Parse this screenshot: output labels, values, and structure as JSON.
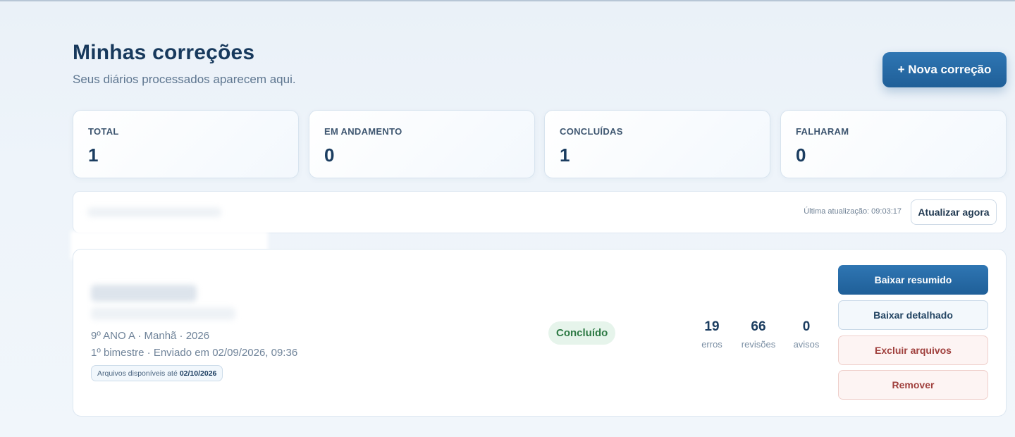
{
  "header": {
    "title": "Minhas correções",
    "subtitle": "Seus diários processados aparecem aqui.",
    "new_button_label": "+ Nova correção"
  },
  "stats": [
    {
      "label": "TOTAL",
      "value": "1"
    },
    {
      "label": "EM ANDAMENTO",
      "value": "0"
    },
    {
      "label": "CONCLUÍDAS",
      "value": "1"
    },
    {
      "label": "FALHARAM",
      "value": "0"
    }
  ],
  "toolbar": {
    "last_update": "Última atualização: 09:03:17",
    "refresh_label": "Atualizar agora"
  },
  "job": {
    "class_info": "9º ANO A · Manhã · 2026",
    "period_info": "1º bimestre · Enviado em 02/09/2026, 09:36",
    "availability_prefix": "Arquivos disponíveis até",
    "availability_date": "02/10/2026",
    "status": "Concluído",
    "metrics": [
      {
        "value": "19",
        "label": "erros"
      },
      {
        "value": "66",
        "label": "revisões"
      },
      {
        "value": "0",
        "label": "avisos"
      }
    ],
    "actions": {
      "download_summary": "Baixar resumido",
      "download_detailed": "Baixar detalhado",
      "delete_files": "Excluir arquivos",
      "remove": "Remover"
    }
  },
  "colors": {
    "primary": "#1f5f98",
    "title": "#17395c",
    "success_bg": "#e6f4eb",
    "success_text": "#2e7a45",
    "danger_text": "#a0403d"
  }
}
